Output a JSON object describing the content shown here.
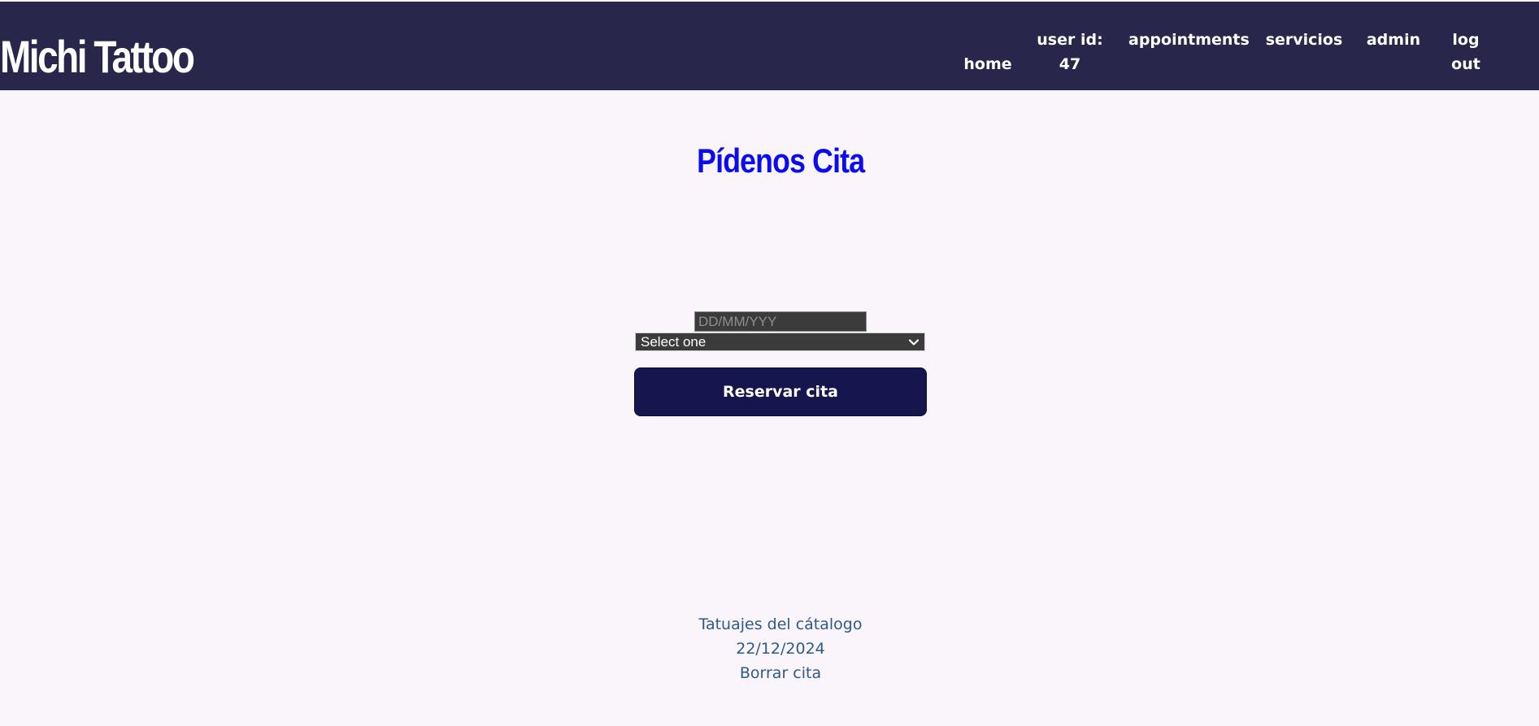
{
  "header": {
    "brand": "Michi Tattoo",
    "nav": {
      "home": "home",
      "user_id_label": "user id:",
      "user_id_value": "47",
      "appointments": "appointments",
      "servicios": "servicios",
      "admin": "admin",
      "logout_line1": "log",
      "logout_line2": "out"
    }
  },
  "main": {
    "title": "Pídenos Cita",
    "date_placeholder": "DD/MM/YYY",
    "select_value": "Select one",
    "submit_label": "Reservar cita"
  },
  "appointment": {
    "service": "Tatuajes del cátalogo",
    "date": "22/12/2024",
    "delete_label": "Borrar cita"
  },
  "colors": {
    "header_bg": "#29264b",
    "page_bg": "#faf5fa",
    "title": "#0b0bf2",
    "button_bg": "#16164e",
    "link_text": "#2d5a88"
  }
}
